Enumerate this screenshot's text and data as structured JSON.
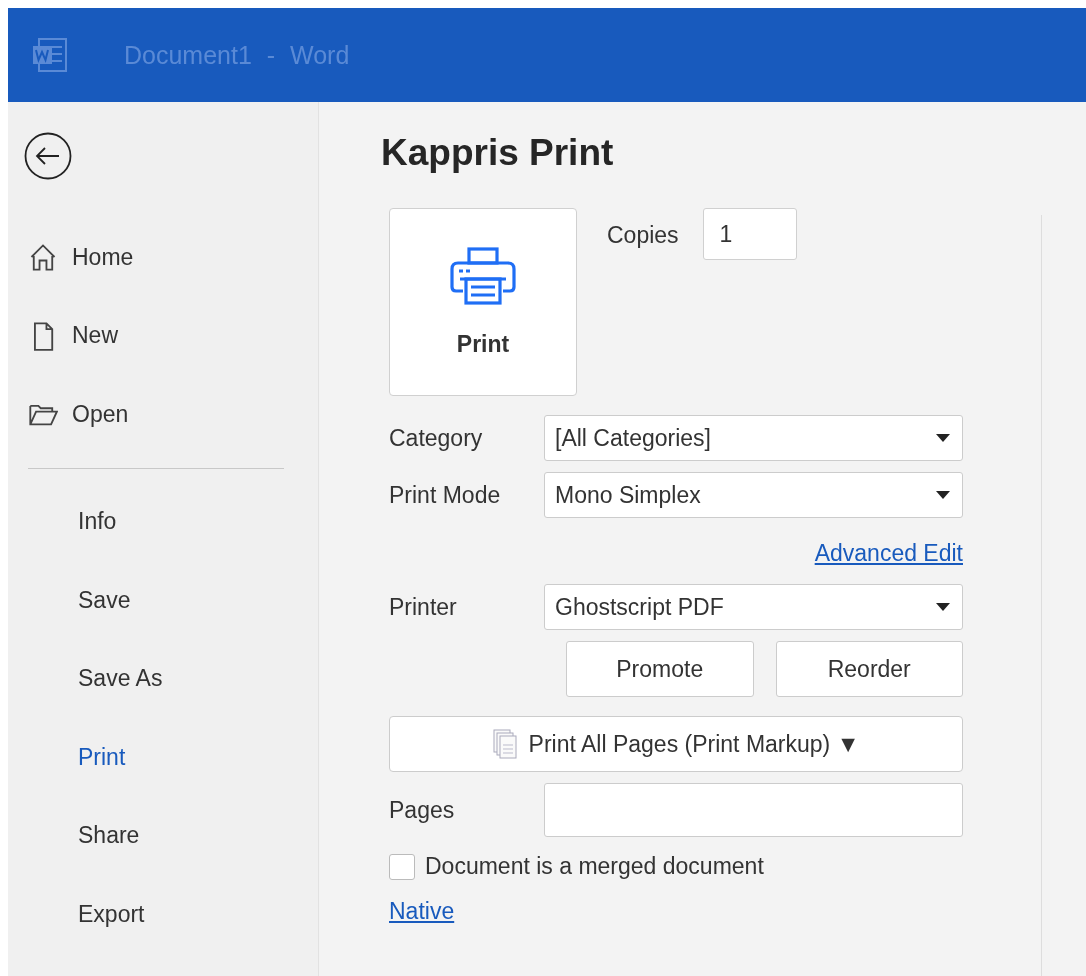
{
  "window": {
    "title": "Document1 - Word"
  },
  "sidebar": {
    "items": [
      {
        "label": "Home",
        "kind": "home",
        "selected": false
      },
      {
        "label": "New",
        "kind": "page",
        "selected": false
      },
      {
        "label": "Open",
        "kind": "folder",
        "selected": false
      },
      {
        "label": "Info",
        "kind": "plain",
        "selected": false
      },
      {
        "label": "Save",
        "kind": "plain",
        "selected": false
      },
      {
        "label": "Save As",
        "kind": "plain",
        "selected": false
      },
      {
        "label": "Print",
        "kind": "plain",
        "selected": true
      },
      {
        "label": "Share",
        "kind": "plain",
        "selected": false
      },
      {
        "label": "Export",
        "kind": "plain",
        "selected": false
      }
    ]
  },
  "main": {
    "heading": "Kappris Print",
    "print_button": "Print",
    "copies": {
      "label": "Copies",
      "value": "1"
    },
    "category": {
      "label": "Category",
      "value": "[All Categories]"
    },
    "print_mode": {
      "label": "Print Mode",
      "value": "Mono Simplex"
    },
    "advanced_link": "Advanced Edit",
    "printer": {
      "label": "Printer",
      "value": "Ghostscript PDF"
    },
    "buttons": [
      "Promote",
      "Reorder"
    ],
    "pages_button": "Print All Pages (Print Markup) ▼",
    "pages": {
      "label": "Pages"
    },
    "merged": {
      "label": "Document is a merged document",
      "checked": false
    },
    "native_link": "Native"
  }
}
